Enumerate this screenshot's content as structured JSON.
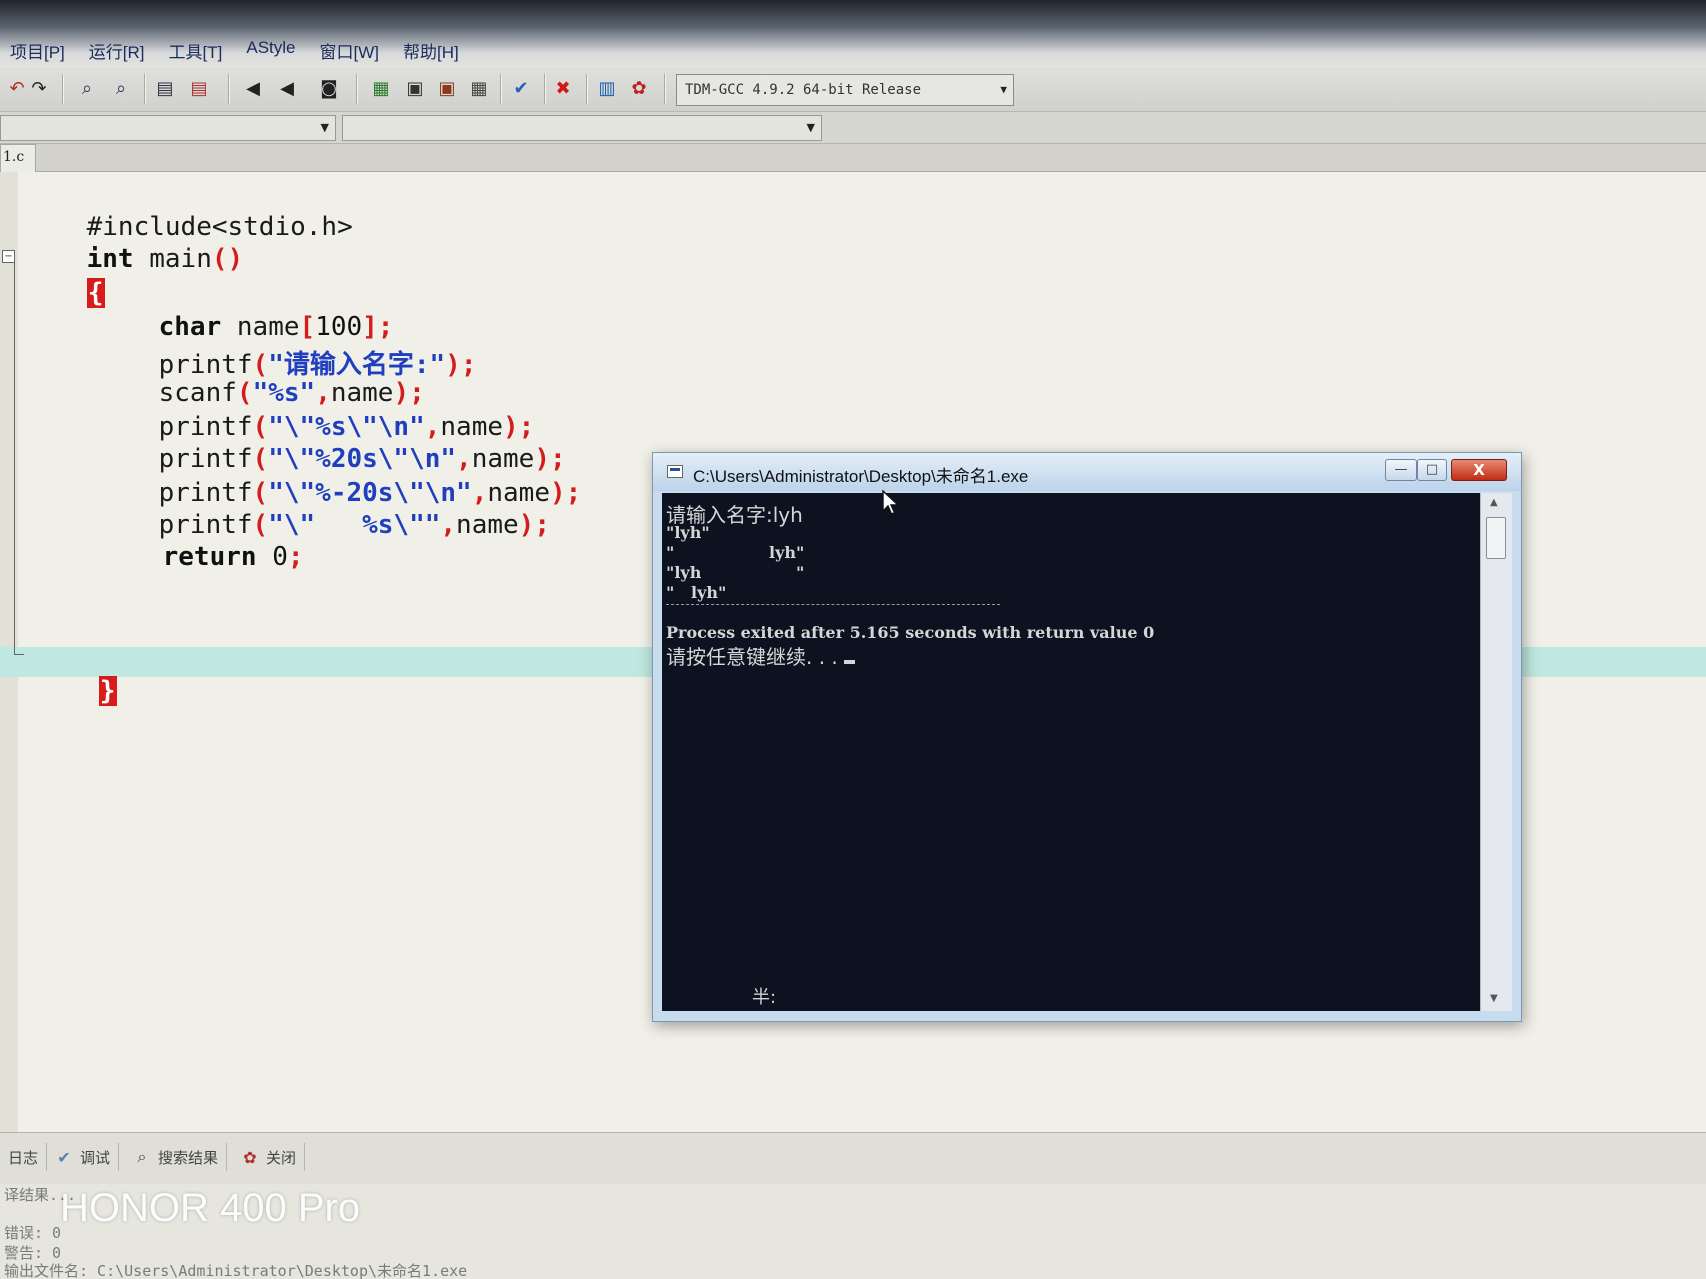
{
  "menu": {
    "items": [
      "项目[P]",
      "运行[R]",
      "工具[T]",
      "AStyle",
      "窗口[W]",
      "帮助[H]"
    ]
  },
  "toolbar": {
    "compiler": "TDM-GCC 4.9.2 64-bit Release"
  },
  "tabs": {
    "file": "1.c"
  },
  "code": {
    "include": "#include<stdio.h>",
    "main_kw": "int",
    "main_rest": " main",
    "main_parens": "()",
    "brace_open": "{",
    "decl_kw": "char",
    "decl_rest": " name",
    "decl_bracket_open": "[",
    "decl_size": "100",
    "decl_bracket_close": "];",
    "l1_fn": "printf",
    "l1_p": "(",
    "l1_str": "\"请输入名字:\"",
    "l1_end": ");",
    "l2_fn": "scanf",
    "l2_p": "(",
    "l2_str": "\"%s\"",
    "l2_comma": ",",
    "l2_arg": "name",
    "l2_end": ");",
    "l3_fn": "printf",
    "l3_p": "(",
    "l3_str": "\"\\\"%s\\\"\\n\"",
    "l3_comma": ",",
    "l3_arg": "name",
    "l3_end": ");",
    "l4_fn": "printf",
    "l4_p": "(",
    "l4_str": "\"\\\"%20s\\\"\\n\"",
    "l4_comma": ",",
    "l4_arg": "name",
    "l4_end": ");",
    "l5_fn": "printf",
    "l5_p": "(",
    "l5_str": "\"\\\"%-20s\\\"\\n\"",
    "l5_comma": ",",
    "l5_arg": "name",
    "l5_end": ");",
    "l6_fn": "printf",
    "l6_p": "(",
    "l6_str": "\"\\\"   %s\\\"\"",
    "l6_comma": ",",
    "l6_arg": "name",
    "l6_end": ");",
    "ret_kw": "return",
    "ret_val": " 0",
    "ret_end": ";",
    "brace_close": "}"
  },
  "console": {
    "title": "C:\\Users\\Administrator\\Desktop\\未命名1.exe",
    "minimize": "—",
    "maximize": "□",
    "close": "X",
    "line1": "请输入名字:lyh",
    "line2": "\"lyh\"",
    "line3": "\"                 lyh\"",
    "line4": "\"lyh                 \"",
    "line5": "\"   lyh\"",
    "line6": "Process exited after 5.165 seconds with return value 0",
    "line7": "请按任意键继续. . . ",
    "ime": "半:"
  },
  "bottom": {
    "tabs": [
      "日志",
      "调试",
      "搜索结果",
      "关闭"
    ],
    "out1": "译结果...",
    "out2": "错误: 0",
    "out3": "警告: 0",
    "out4": "输出文件名: C:\\Users\\Administrator\\Desktop\\未命名1.exe"
  },
  "watermark": "HONOR 400 Pro",
  "icons": [
    "undo-icon",
    "redo-icon",
    "find-icon",
    "replace-icon",
    "indent-icon",
    "unindent-icon",
    "back-icon",
    "forward-icon",
    "bookmark-icon",
    "compile-icon",
    "run-icon",
    "compile-run-icon",
    "rebuild-icon",
    "check-icon",
    "stop-icon",
    "chart-icon",
    "debug-icon"
  ]
}
